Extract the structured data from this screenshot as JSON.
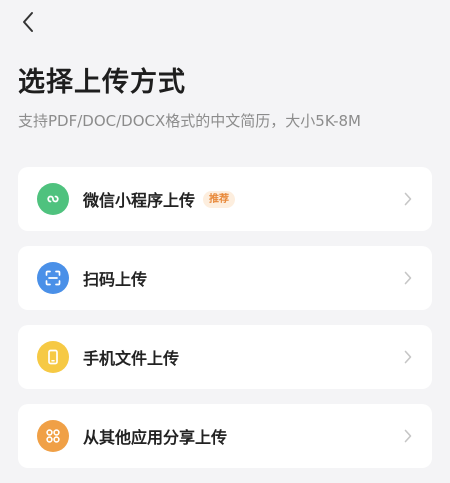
{
  "header": {
    "title": "选择上传方式",
    "subtitle": "支持PDF/DOC/DOCX格式的中文简历，大小5K-8M"
  },
  "options": [
    {
      "label": "微信小程序上传",
      "badge": "推荐",
      "icon": "mini-program-icon",
      "color": "#4fc27e"
    },
    {
      "label": "扫码上传",
      "icon": "scan-icon",
      "color": "#4a90e8"
    },
    {
      "label": "手机文件上传",
      "icon": "phone-icon",
      "color": "#f6c944"
    },
    {
      "label": "从其他应用分享上传",
      "icon": "apps-icon",
      "color": "#f0a046"
    }
  ],
  "colors": {
    "background": "#f4f4f6",
    "card": "#ffffff",
    "badge_bg": "#fdeede",
    "badge_text": "#e8893a"
  }
}
